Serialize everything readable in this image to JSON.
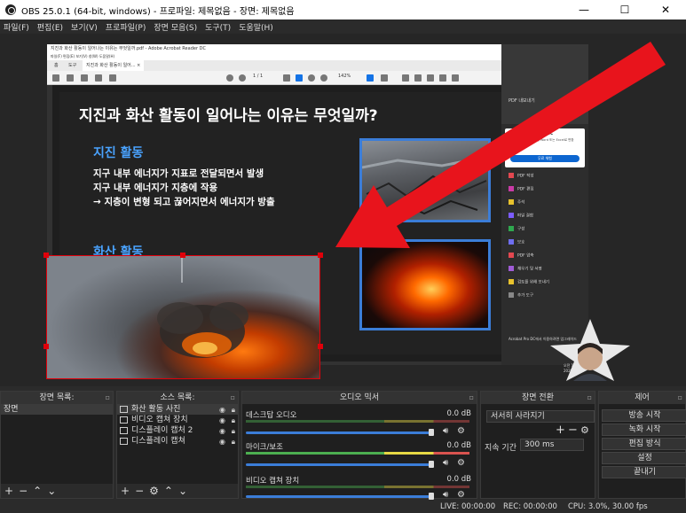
{
  "window": {
    "title": "OBS 25.0.1 (64-bit, windows) - 프로파일: 제목없음 - 장면: 제목없음",
    "min": "—",
    "max": "☐",
    "close": "✕"
  },
  "menu": [
    "파일(F)",
    "편집(E)",
    "보기(V)",
    "프로파일(P)",
    "장면 모음(S)",
    "도구(T)",
    "도움말(H)"
  ],
  "capture": {
    "acrobat_title": "지진과 화산 활동이 일어나는 이유는 무엇일까.pdf - Adobe Acrobat Reader DC",
    "acrobat_menu": "파일(F)  편집(E)  보기(V)  창(W)  도움말(H)",
    "tabs": [
      "홈",
      "도구",
      "지진과 화산 활동이 일어... ×"
    ],
    "page": "1 / 1",
    "zoom": "142%",
    "slide": {
      "title": "지진과 화산 활동이 일어나는 이유는 무엇일까?",
      "eq_heading": "지진 활동",
      "eq_lines": [
        "지구 내부 에너지가 지표로 전달되면서 발생",
        "지구 내부 에너지가 지층에 작용",
        "→ 지층이 변형 되고 끊어지면서 에너지가 방출"
      ],
      "vol_heading": "화산 활동"
    },
    "side": {
      "export": "PDF 내보내기",
      "card_title": "Adobe Acrobat Pro DC",
      "card_desc": "온라인으로 PDF 파일을 Word 또는 Excel로 변환",
      "card_button": "무료 체험",
      "tools": [
        "PDF 작성",
        "PDF 편집",
        "주석",
        "파일 결합",
        "구성",
        "보호",
        "PDF 압축",
        "채우기 및 서명",
        "검토를 위해 보내기",
        "추가 도구"
      ],
      "promo": "Acrobat Pro DC에서 이용하려면 업그레이드",
      "clock_time": "오전 11:58",
      "clock_date": "2020-04-09"
    }
  },
  "docks": {
    "scenes": {
      "title": "장면 목록:",
      "items": [
        "장면"
      ]
    },
    "sources": {
      "title": "소스 목록:",
      "items": [
        "화산 활동 사진",
        "비디오 캡쳐 장치",
        "디스플레이 캡처 2",
        "디스플레이 캡쳐"
      ]
    },
    "mixer": {
      "title": "오디오 믹서",
      "channels": [
        {
          "name": "데스크탑 오디오",
          "db": "0.0 dB"
        },
        {
          "name": "마이크/보조",
          "db": "0.0 dB"
        },
        {
          "name": "비디오 캡쳐 장치",
          "db": "0.0 dB"
        }
      ]
    },
    "transitions": {
      "title": "장면 전환",
      "selected": "서서히 사라지기",
      "duration_label": "지속 기간",
      "duration": "300 ms"
    },
    "controls": {
      "title": "제어",
      "buttons": [
        "방송 시작",
        "녹화 시작",
        "편집 방식",
        "설정",
        "끝내기"
      ]
    }
  },
  "status": {
    "live": "LIVE: 00:00:00",
    "rec": "REC: 00:00:00",
    "cpu": "CPU: 3.0%, 30.00 fps"
  },
  "colors": {
    "arrow": "#e8141c",
    "selection": "#e0000a",
    "slide_heading": "#4aa3ff",
    "frame": "#3b7dd8"
  }
}
